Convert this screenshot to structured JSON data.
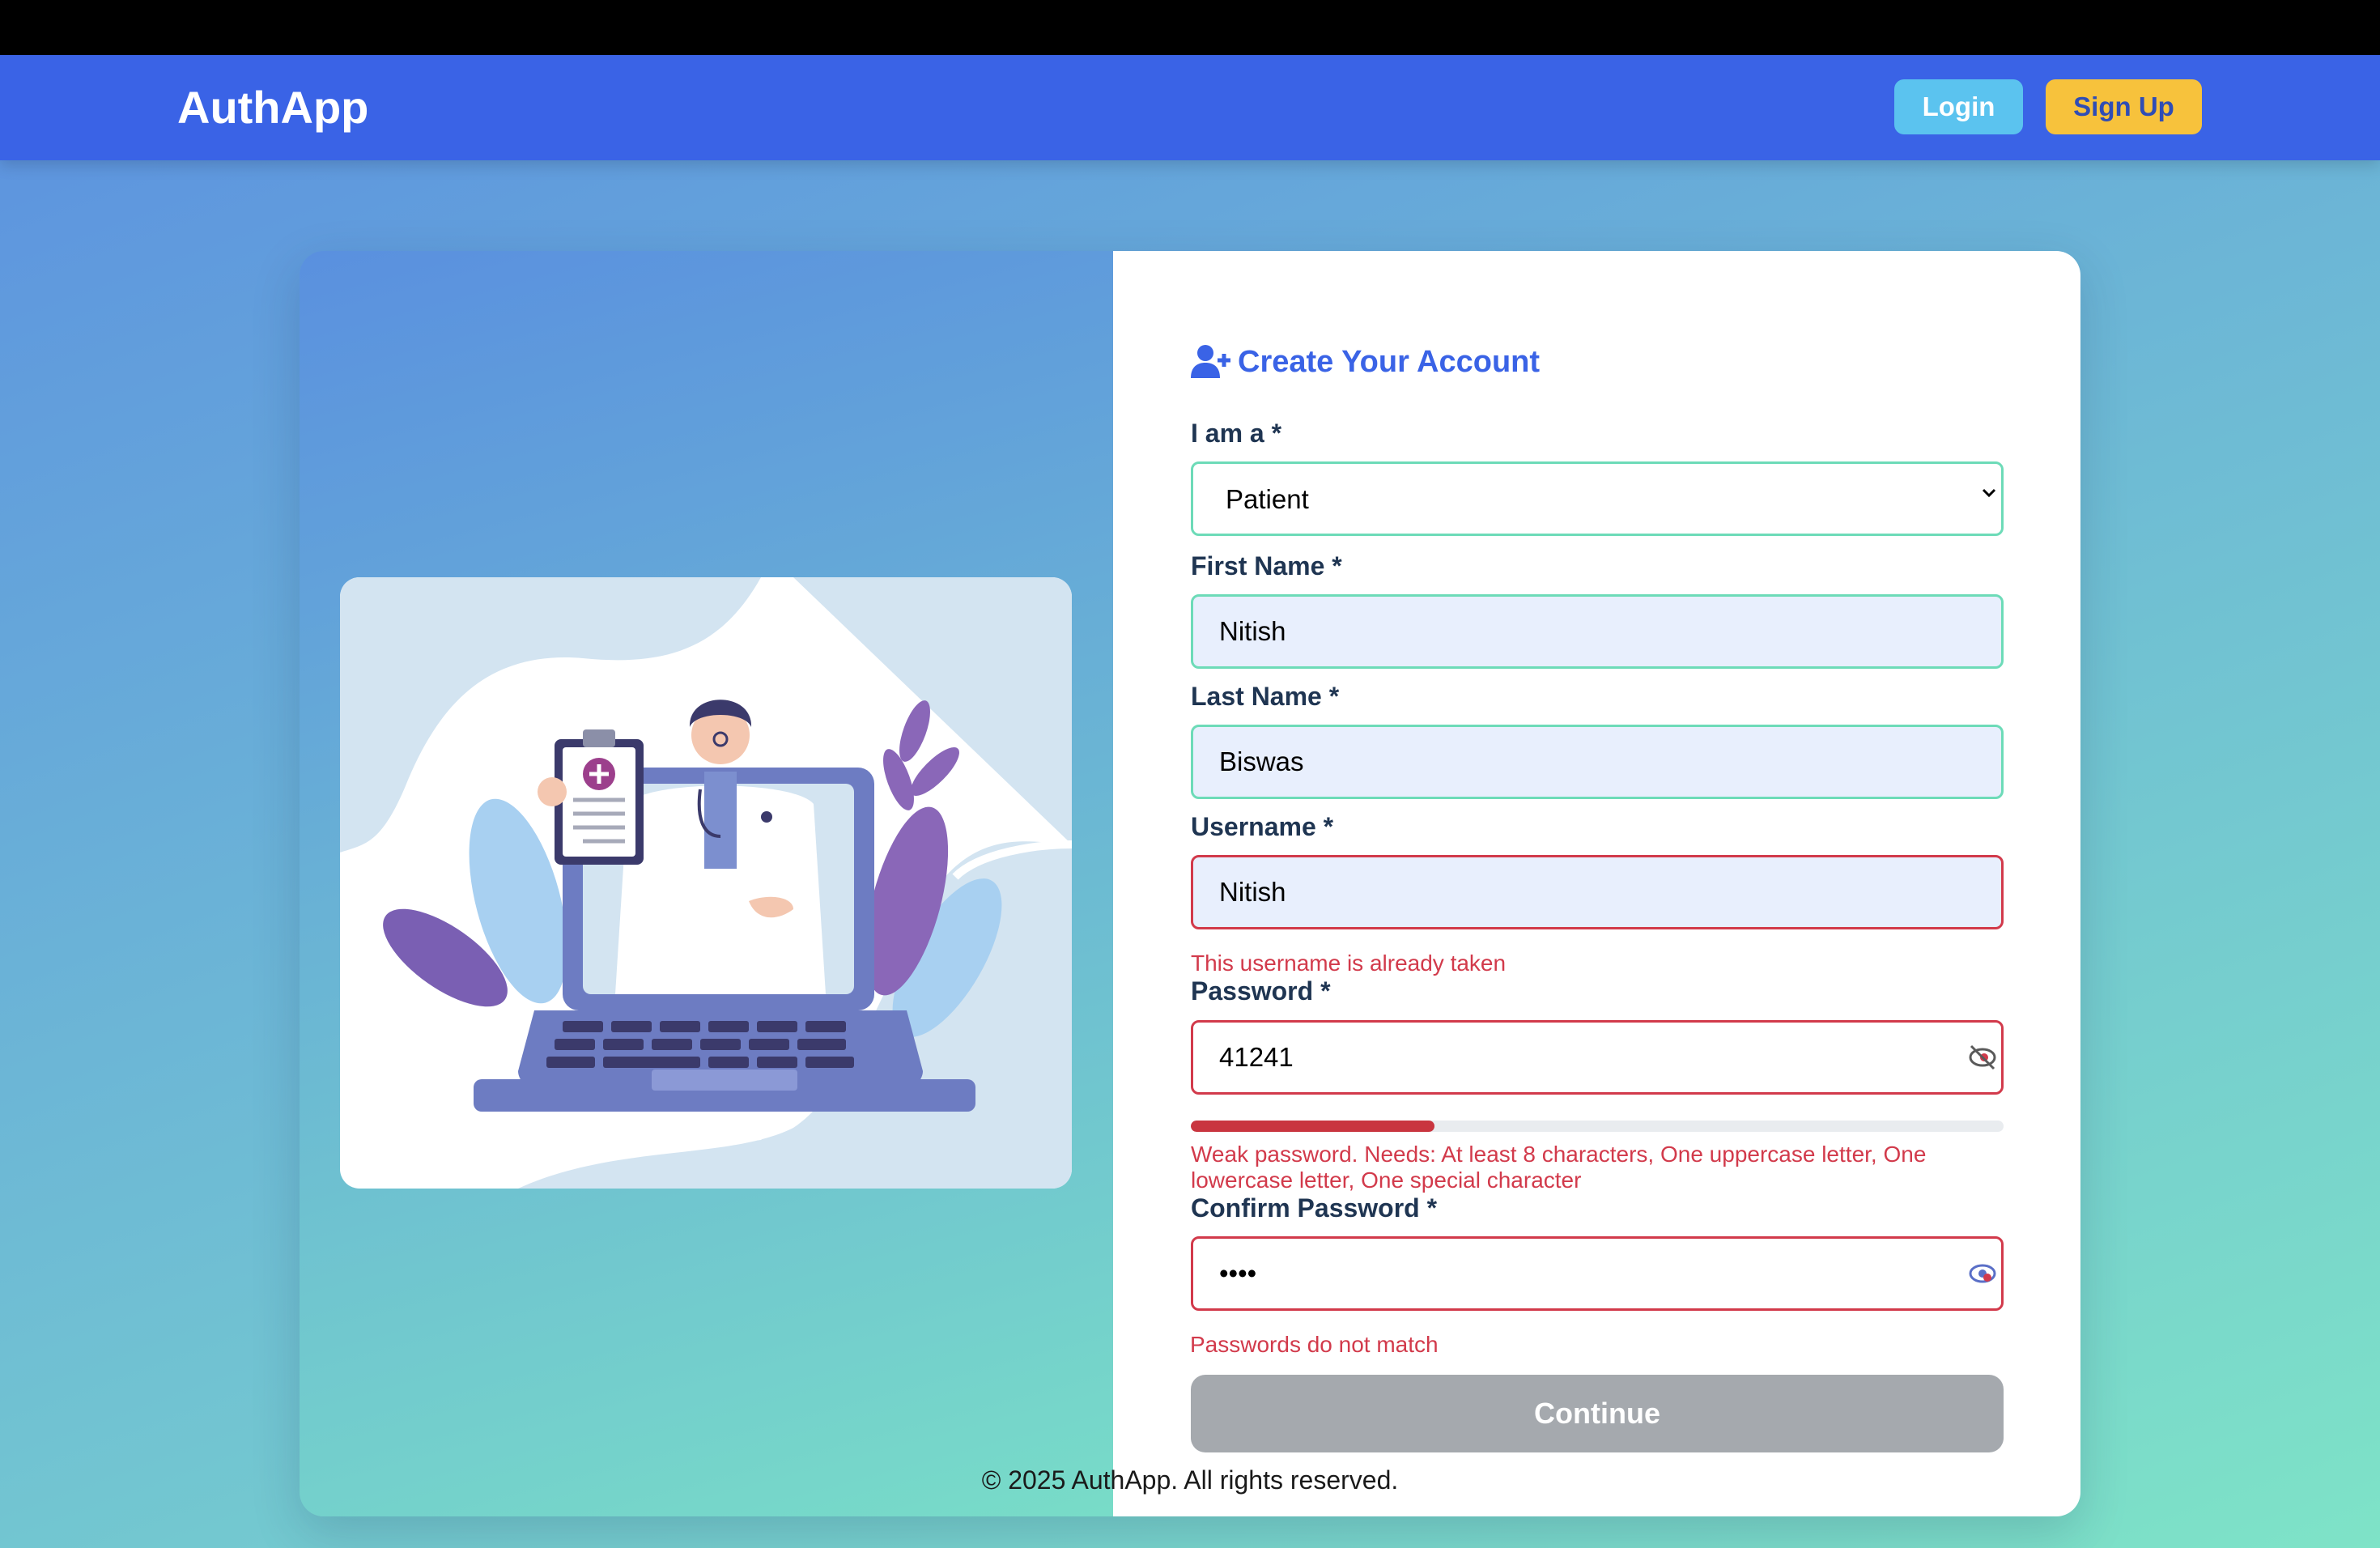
{
  "app": {
    "name": "AuthApp"
  },
  "nav": {
    "login_label": "Login",
    "signup_label": "Sign Up"
  },
  "form": {
    "title": "Create Your Account",
    "role": {
      "label": "I am a *",
      "selected": "Patient",
      "options": [
        "Patient"
      ]
    },
    "first_name": {
      "label": "First Name *",
      "value": "Nitish"
    },
    "last_name": {
      "label": "Last Name *",
      "value": "Biswas"
    },
    "username": {
      "label": "Username *",
      "value": "Nitish",
      "error": "This username is already taken"
    },
    "password": {
      "label": "Password *",
      "value": "41241",
      "strength_fraction": 0.3,
      "strength_message": "Weak password. Needs: At least 8 characters, One uppercase letter, One lowercase letter, One special character"
    },
    "confirm_password": {
      "label": "Confirm Password *",
      "value": "••••",
      "error": "Passwords do not match"
    },
    "submit_label": "Continue"
  },
  "footer": {
    "text": "© 2025 AuthApp. All rights reserved."
  },
  "icons": {
    "title": "user-plus-icon",
    "password_toggle": "eye-slash-icon",
    "confirm_toggle": "eye-icon",
    "select": "chevron-down-icon"
  },
  "colors": {
    "primary": "#3a63e6",
    "login_button": "#5bc3ef",
    "signup_button": "#f7c23c",
    "valid_border": "#6ddbb8",
    "error": "#d23a4b",
    "disabled_button": "#a5a9ae"
  }
}
